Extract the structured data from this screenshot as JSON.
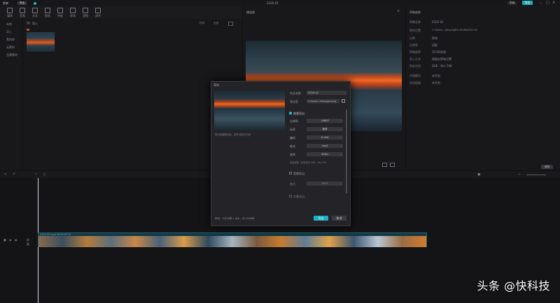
{
  "app": {
    "name": "剪映",
    "badge": "专业",
    "title": "0320-02"
  },
  "window_controls": {
    "export": "导出",
    "layout": "布局"
  },
  "toolbar": {
    "items": [
      "媒体",
      "音频",
      "文本",
      "贴纸",
      "特效",
      "转场",
      "滤镜",
      "调节"
    ]
  },
  "sidebar": {
    "items": [
      "本地",
      "导入",
      "素材库",
      "云素材",
      "品牌素材"
    ]
  },
  "media": {
    "header": "导入",
    "filter_labels": [
      "排序",
      "全部"
    ]
  },
  "player": {
    "title": "播放器"
  },
  "draft": {
    "title": "草稿参数",
    "rows": [
      {
        "k": "草稿名称",
        "v": "0320-02"
      },
      {
        "k": "保存位置",
        "v": "C:/Users/.../JianyingPro Drafts/0320-02"
      },
      {
        "k": "比例",
        "v": "原始"
      },
      {
        "k": "分辨率",
        "v": "适配"
      },
      {
        "k": "草稿帧率",
        "v": "30.00帧/秒"
      },
      {
        "k": "导入方式",
        "v": "保留在原有位置"
      },
      {
        "k": "色彩空间",
        "v": "SDR - Rec.709"
      },
      {
        "k": "代理模式",
        "v": "未开启"
      },
      {
        "k": "自由层级",
        "v": "未开启"
      }
    ],
    "modify_button": "修改"
  },
  "timeline": {
    "track_label": "封面",
    "clip_title": "0320-02.mp4  00:00:47:11"
  },
  "export_modal": {
    "title": "导出",
    "file_name_label": "作品名称",
    "file_name": "0320-02",
    "path_label": "导出至",
    "path_value": "C:/Users/.../Videos/Jianying",
    "video_section": "视频导出",
    "video_rows": [
      {
        "k": "分辨率",
        "v": "1080P"
      },
      {
        "k": "码率",
        "v": "推荐"
      },
      {
        "k": "编码",
        "v": "H.264"
      },
      {
        "k": "格式",
        "v": "mp4"
      },
      {
        "k": "帧率",
        "v": "30fps"
      }
    ],
    "hint": "高级设置：色彩空间 SDR - Rec.709",
    "cover_caption": "导出前编辑封面，更好地发布作品",
    "audio_section": "音频导出",
    "audio_format_label": "格式",
    "audio_format": "MP3",
    "subtitle_section": "字幕导出",
    "footer_info": "时长：1分16秒 | 大小：约 123MB",
    "export_button": "导出",
    "cancel_button": "取消"
  },
  "watermark": "头条 @快科技"
}
